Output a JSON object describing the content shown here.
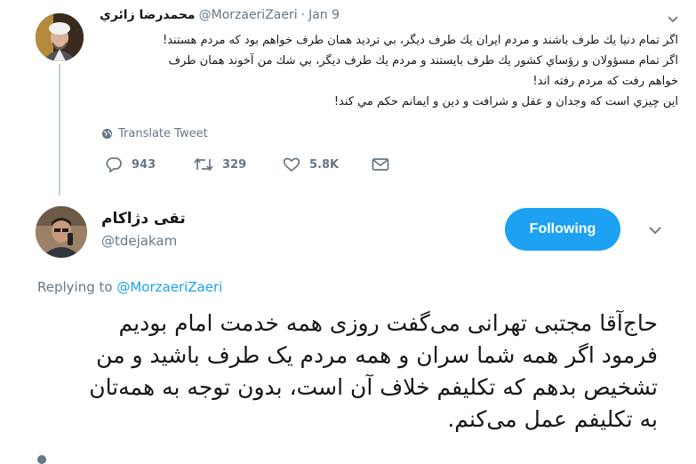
{
  "tweet": {
    "author_name": "محمدرضا زائري",
    "author_handle": "@MorzaeriZaeri",
    "separator": "·",
    "date": "Jan 9",
    "lines": [
      "اگر تمام دنيا يك طرف باشند و مردم ايران يك طرف ديگر، بي ترديد همان طرف خواهم بود كه مردم هستند!",
      "اگر تمام مسؤولان و رؤساي كشور يك طرف بايستند و مردم يك طرف ديگر، بي شك من آخوند همان طرف",
      "خواهم رفت كه مردم رفته اند!",
      "اين چيزي است كه وجدان و عقل و شرافت و دين و ايمانم حكم مي كند!"
    ],
    "translate_label": "Translate Tweet",
    "replies": "943",
    "retweets": "329",
    "likes": "5.8K"
  },
  "reply": {
    "author_name": "تقی دژاکام",
    "author_handle": "@tdejakam",
    "follow_label": "Following",
    "replying_prefix": "Replying to",
    "replying_to": "@MorzaeriZaeri",
    "lines": [
      "حاج‌آقا مجتبی تهرانی می‌گفت روزی همه خدمت امام بودیم",
      "فرمود اگر همه شما سران و همه مردم یک طرف باشید و من",
      "تشخیص بدهم که تکلیفم خلاف آن است، بدون توجه به همه‌تان",
      "به تکلیفم عمل می‌کنم."
    ]
  },
  "colors": {
    "accent": "#1da1f2",
    "muted": "#657786",
    "text": "#14171a"
  }
}
